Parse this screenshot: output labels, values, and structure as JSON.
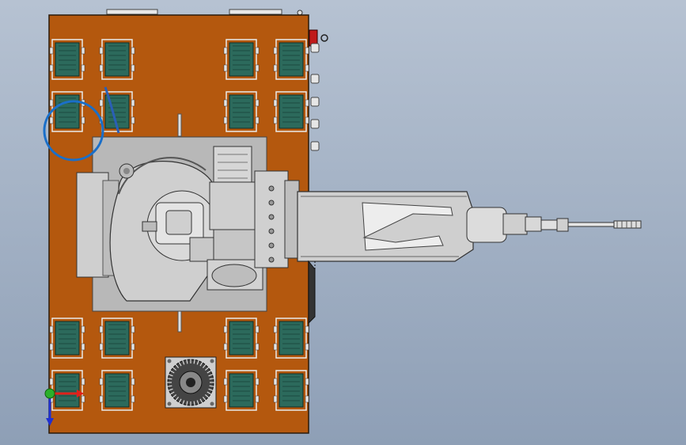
{
  "viewport": {
    "background_top": "#b6c2d2",
    "background_bottom": "#8e9fb6"
  },
  "model": {
    "base_plate_color": "#b4580e",
    "base_plate_edge": "#2a1a0a",
    "motor_body_color": "#2c6a5c",
    "motor_frame_color": "#eaeaea",
    "mount_plate_color": "#b8b8b8",
    "robot_body_color": "#cfcfcf",
    "robot_shadow_color": "#9a9a9a",
    "highlight_ring_color": "#1a6fc9",
    "cable_color": "#2a5fb6",
    "connector_red": "#c01a1a"
  },
  "triad": {
    "x_axis_color": "#e0201a",
    "y_axis_color": "#2ab02a",
    "z_axis_color": "#2030d0",
    "icons": [
      "x-axis-arrow-icon",
      "y-axis-arrow-icon",
      "z-axis-arrow-icon"
    ]
  }
}
